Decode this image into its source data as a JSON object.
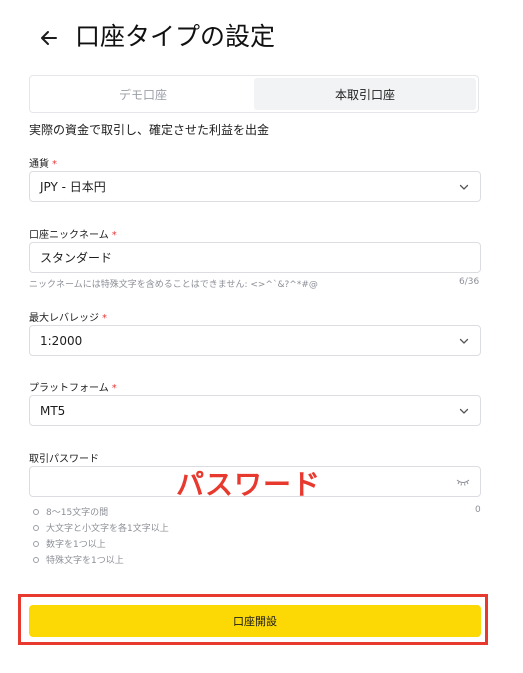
{
  "header": {
    "title": "口座タイプの設定"
  },
  "tabs": [
    {
      "label": "デモ口座"
    },
    {
      "label": "本取引口座"
    }
  ],
  "description": "実際の資金で取引し、確定させた利益を出金",
  "currency": {
    "label": "通貨",
    "required_mark": "*",
    "value": "JPY - 日本円"
  },
  "nickname": {
    "label": "口座ニックネーム",
    "required_mark": "*",
    "value": "スタンダード",
    "hint": "ニックネームには特殊文字を含めることはできません: <>^`&?^*#@",
    "counter": "6/36"
  },
  "leverage": {
    "label": "最大レバレッジ",
    "required_mark": "*",
    "value": "1:2000"
  },
  "platform": {
    "label": "プラットフォーム",
    "required_mark": "*",
    "value": "MT5"
  },
  "password": {
    "label": "取引パスワード",
    "value": "",
    "counter": "0",
    "rules": [
      "8～15文字の間",
      "大文字と小文字を各1文字以上",
      "数字を1つ以上",
      "特殊文字を1つ以上"
    ]
  },
  "annotation": {
    "text": "パスワード",
    "color": "#e8392f"
  },
  "submit": {
    "label": "口座開設"
  },
  "colors": {
    "accent": "#fcd905",
    "highlight": "#e8392f",
    "required": "#e6393b"
  }
}
